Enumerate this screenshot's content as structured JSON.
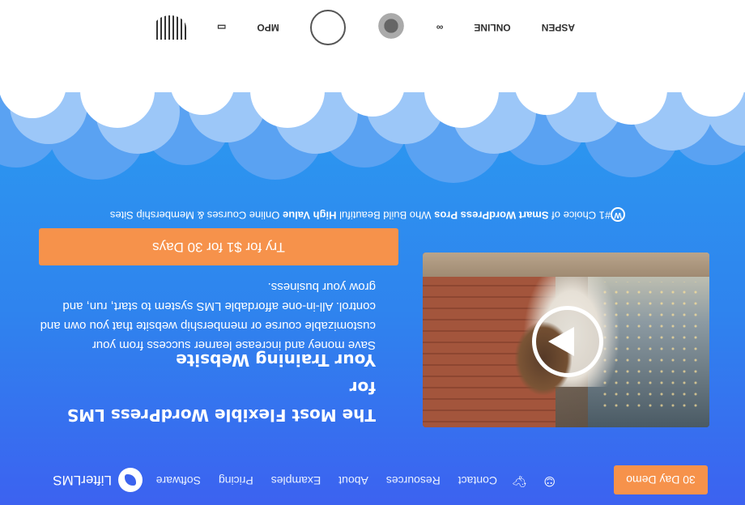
{
  "nav": {
    "logo_text": "LifterLMS",
    "links": [
      "Software",
      "Pricing",
      "Examples",
      "About",
      "Resources",
      "Contact"
    ],
    "demo_label": "30 Day Demo"
  },
  "hero": {
    "headline_line1": "The Most Flexible WordPress LMS for",
    "headline_line2": "Your Training Website",
    "subtext": "Save money and increase learner success from your customizable course or membership website that you own and control. All-in-one affordable LMS system to start, run, and grow your business.",
    "cta_label": "Try for $1 for 30 Days"
  },
  "tagline": {
    "prefix": "#1 Choice of ",
    "bold1": "Smart WordPress Pros",
    "mid1": " Who Build Beautiful ",
    "bold2": "High Value",
    "suffix": " Online Courses & Membership Sites"
  },
  "logos": {
    "brands": [
      "MPO",
      "ONLINE",
      "ASPEN"
    ]
  },
  "colors": {
    "hero_top": "#3c62f0",
    "hero_bottom": "#2b9bf0",
    "accent_orange": "#f6924b",
    "text_white": "#ffffff"
  },
  "icons": [
    "lifterlms-logo-icon",
    "twitter-icon",
    "user-icon",
    "wordpress-icon",
    "play-icon"
  ]
}
